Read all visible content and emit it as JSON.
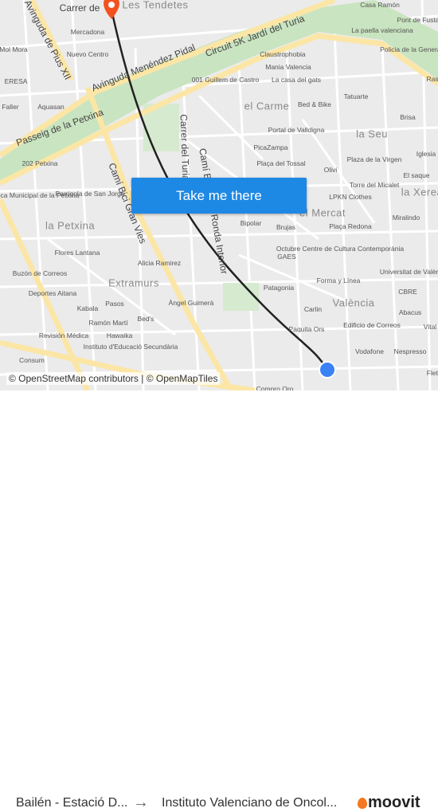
{
  "map": {
    "labels": [
      "Carrer de",
      "Mercadona",
      "Nuevo Centro",
      "Avinguda Menéndez Pidal",
      "Circuit 5K Jardí del Turia",
      "Avinguda de Pius XII",
      "Passeig de la Petxina",
      "Camí Bici Gran Vies",
      "Carrer del Turia",
      "Camí Bici de la Ronda Interior",
      "Claustrophobia",
      "Mania Valencia",
      "La casa del gats",
      "001 Guillem de Castro",
      "el Carme",
      "Bed & Bike",
      "Tatuarte",
      "Portal de Valldigna",
      "la Seu",
      "PicaZampa",
      "Plaça del Tossal",
      "Plaza de la Virgen",
      "Olivi",
      "Torre del Micalet",
      "LPKN Clothes",
      "la Xerea",
      "el Mercat",
      "Bipolar",
      "Brujas",
      "Plaça Redona",
      "Miralindo",
      "Octubre Centre de Cultura Contemporània",
      "GAES",
      "Universitat de València",
      "Patagonia",
      "Forma y Línea",
      "CBRE",
      "València",
      "Carlin",
      "Abacus",
      "Paquita Ors",
      "Edificio de Correos",
      "Vodafone",
      "Nespresso",
      "la Petxina",
      "Flores Lantana",
      "Alicia Ramirez",
      "Extramurs",
      "Buzón de Correos",
      "Deportes Aitana",
      "Kabala",
      "Pasos",
      "Ramón Martí",
      "Bed's",
      "Àngel Guimerà",
      "Hawaika",
      "Revisión Médica",
      "Instituto d'Educació Secundària",
      "Consum",
      "Parriqola de San Jorge",
      "Biblioteca Municipal de la Petxina",
      "202 Petxina",
      "ERESA",
      "Aquasan",
      "Faller",
      "Mol Mora",
      "Les Tendetes",
      "Casa Ramón",
      "La paella valenciana",
      "Pont de Fusta",
      "Policia de la Generalitat",
      "Brisa",
      "Iglesia",
      "El saque",
      "Compro Oro",
      "Ras",
      "Vital",
      "Fletx"
    ],
    "route_color": "#222222",
    "origin_marker_color": "#f4511e",
    "destination_marker_color": "#3b82f6",
    "park_color": "#c9e4c0",
    "road_color": "#fbe6a6"
  },
  "cta": {
    "label": "Take me there",
    "color": "#1e88e5"
  },
  "attribution": "© OpenStreetMap contributors | © OpenMapTiles",
  "footer": {
    "from": "Bailén - Estació D...",
    "arrow_icon": "arrow-right-icon",
    "to": "Instituto Valenciano de Oncol...",
    "brand": "moovit",
    "brand_color": "#f47721"
  }
}
